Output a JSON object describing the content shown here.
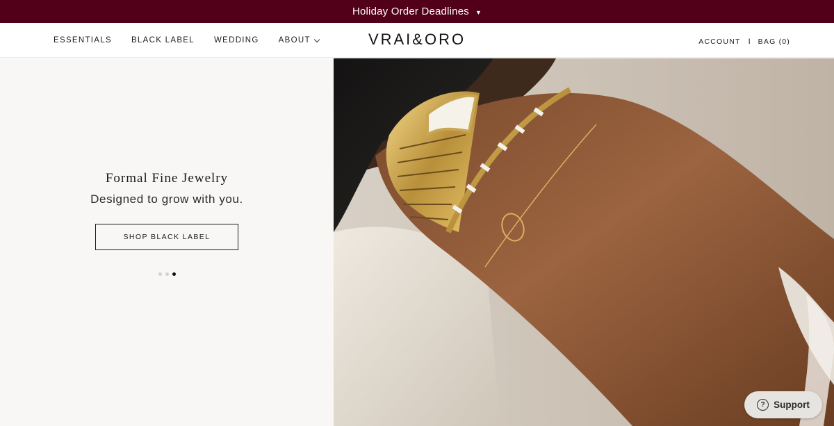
{
  "banner": {
    "text": "Holiday Order Deadlines",
    "caret": "▼"
  },
  "nav": {
    "items": [
      {
        "label": "ESSENTIALS"
      },
      {
        "label": "BLACK LABEL"
      },
      {
        "label": "WEDDING"
      },
      {
        "label": "ABOUT"
      }
    ]
  },
  "logo": {
    "text": "VRAI&ORO"
  },
  "utility": {
    "account": "ACCOUNT",
    "separator": "I",
    "bag": "BAG (0)"
  },
  "hero": {
    "title": "Formal Fine Jewelry",
    "subtitle": "Designed to grow with you.",
    "cta": "SHOP BLACK LABEL",
    "slides": {
      "count": 3,
      "active": 3
    }
  },
  "support": {
    "label": "Support",
    "icon": "question-circle-icon"
  },
  "colors": {
    "banner": "#520019",
    "hero_left_bg": "#f8f7f5"
  }
}
